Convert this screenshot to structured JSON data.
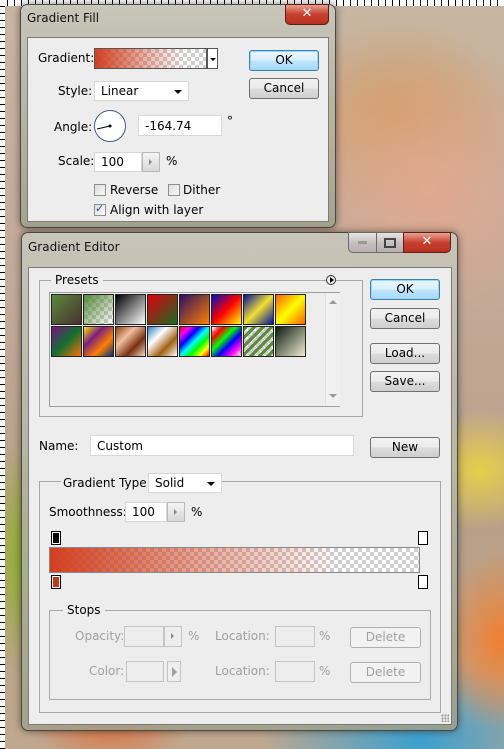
{
  "gradient_fill": {
    "title": "Gradient Fill",
    "close_icon": "close-icon",
    "gradient_label": "Gradient:",
    "style_label": "Style:",
    "style_value": "Linear",
    "angle_label": "Angle:",
    "angle_value": "-164.74",
    "angle_unit": "°",
    "scale_label": "Scale:",
    "scale_value": "100",
    "scale_unit": "%",
    "reverse_label": "Reverse",
    "reverse_checked": false,
    "dither_label": "Dither",
    "dither_checked": false,
    "align_label": "Align with layer",
    "align_checked": true,
    "ok_label": "OK",
    "cancel_label": "Cancel"
  },
  "gradient_editor": {
    "title": "Gradient Editor",
    "presets_label": "Presets",
    "presets": [
      {
        "name": "foreground-to-background",
        "colors": [
          "#5a8a3a",
          "#4a3030"
        ]
      },
      {
        "name": "foreground-to-transparent",
        "colors": [
          "#5a8a3a",
          "transparent"
        ]
      },
      {
        "name": "black-white",
        "colors": [
          "#000000",
          "#ffffff"
        ]
      },
      {
        "name": "red-green",
        "colors": [
          "#e00010",
          "#1a6a20"
        ]
      },
      {
        "name": "violet-orange",
        "colors": [
          "#2a1060",
          "#ff8000"
        ]
      },
      {
        "name": "blue-red-yellow",
        "colors": [
          "#0010c0",
          "#ff0000",
          "#ffff00"
        ]
      },
      {
        "name": "blue-yellow-blue",
        "colors": [
          "#0010a0",
          "#f0e030",
          "#0010a0"
        ]
      },
      {
        "name": "orange-yellow-orange",
        "colors": [
          "#ff6000",
          "#ffff00",
          "#ff6000"
        ]
      },
      {
        "name": "violet-green-orange",
        "colors": [
          "#7a1080",
          "#107030",
          "#ff7000"
        ]
      },
      {
        "name": "yellow-violet-orange-blue",
        "colors": [
          "#ffe000",
          "#7a2080",
          "#ff8000",
          "#003080"
        ]
      },
      {
        "name": "copper",
        "colors": [
          "#8a4010",
          "#f0c0a0",
          "#7a3010",
          "#f0d8c8"
        ]
      },
      {
        "name": "chrome",
        "colors": [
          "#3080c0",
          "#ffffff",
          "#a06010",
          "#ffffff"
        ]
      },
      {
        "name": "spectrum",
        "colors": [
          "#ff0000",
          "#ff00ff",
          "#0000ff",
          "#00ffff",
          "#00ff00",
          "#ffff00",
          "#ff0000"
        ]
      },
      {
        "name": "transparent-rainbow",
        "colors": [
          "transparent",
          "#ff0000",
          "#00ff00",
          "#0000ff",
          "#ff00ff",
          "transparent"
        ]
      },
      {
        "name": "transparent-stripes",
        "colors": [
          "#5a8a3a",
          "transparent"
        ]
      },
      {
        "name": "black-cream",
        "colors": [
          "#0a1a10",
          "#f0ecd0"
        ]
      }
    ],
    "presets_menu_icon": "flyout-arrow-icon",
    "ok_label": "OK",
    "cancel_label": "Cancel",
    "load_label": "Load...",
    "save_label": "Save...",
    "name_label": "Name:",
    "name_value": "Custom",
    "new_label": "New",
    "gradient_type_label": "Gradient Type:",
    "gradient_type_value": "Solid",
    "smoothness_label": "Smoothness:",
    "smoothness_value": "100",
    "smoothness_unit": "%",
    "gradient_color": "#d04020",
    "stops": {
      "group_label": "Stops",
      "opacity_label": "Opacity:",
      "opacity_value": "",
      "opacity_unit": "%",
      "location_label": "Location:",
      "location_unit": "%",
      "delete_label": "Delete",
      "color_label": "Color:"
    },
    "opacity_stops": [
      {
        "location": 0,
        "color": "#000000"
      },
      {
        "location": 100,
        "color": "#ffffff"
      }
    ],
    "color_stops": [
      {
        "location": 0,
        "color": "#c83818"
      },
      {
        "location": 100,
        "color": "#ffffff"
      }
    ]
  }
}
